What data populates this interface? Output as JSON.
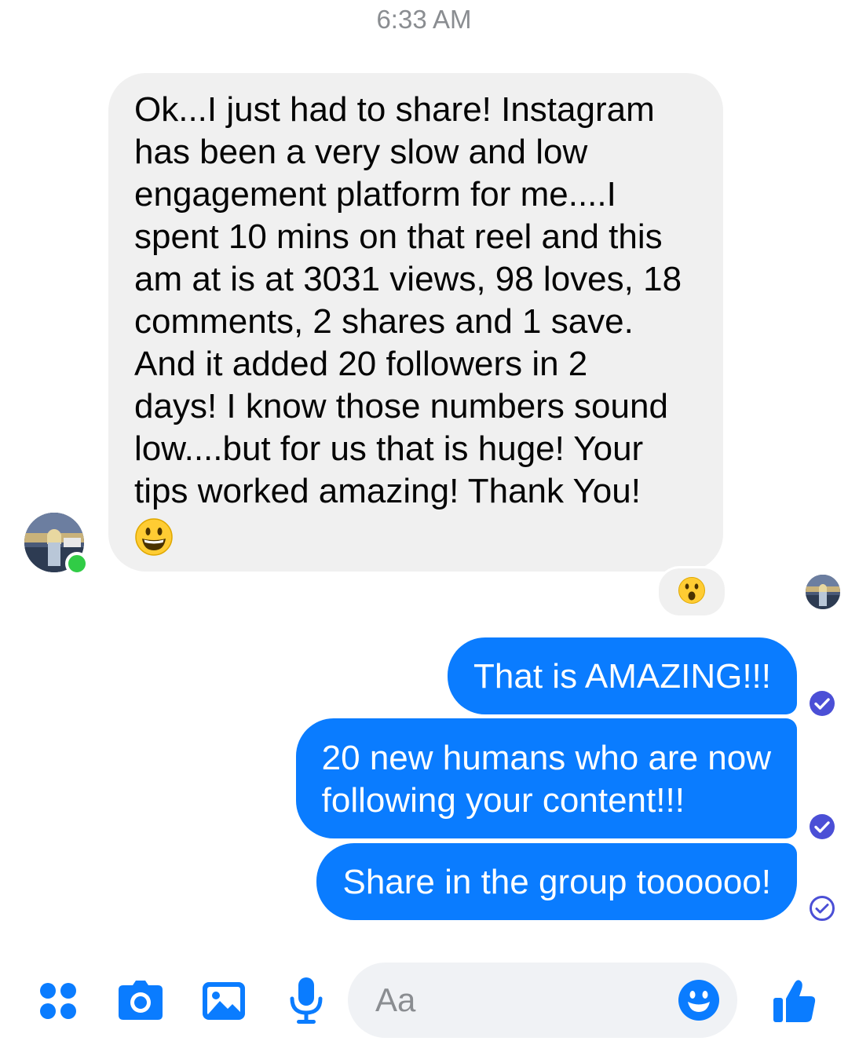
{
  "timestamp": "6:33 AM",
  "incoming_message": {
    "lines": [
      "Ok...I just had to share! Instagram",
      "has been a very slow and low",
      "engagement platform for me....I",
      "spent 10 mins on that reel and this",
      "am at is at 3031 views, 98 loves, 18",
      "comments, 2 shares and 1 save.",
      "And it added 20 followers in 2",
      "days! I know those numbers sound",
      "low....but for us that is huge! Your",
      "tips worked amazing! Thank You!"
    ],
    "emoji": "grinning-face"
  },
  "reaction": "astonished-face",
  "outgoing_messages": [
    {
      "lines": [
        "That is AMAZING!!!"
      ]
    },
    {
      "lines": [
        "20 new humans who are now",
        "following your content!!!"
      ]
    },
    {
      "lines": [
        "Share in the group toooooo!"
      ]
    }
  ],
  "composer": {
    "placeholder": "Aa",
    "icons": [
      "menu-dots-icon",
      "camera-icon",
      "image-icon",
      "microphone-icon",
      "emoji-icon",
      "thumbs-up-icon"
    ]
  },
  "colors": {
    "accent": "#0a7cff",
    "incoming_bubble": "#f0f0f0",
    "online": "#31cc46",
    "read_check": "#4b4fd6"
  }
}
